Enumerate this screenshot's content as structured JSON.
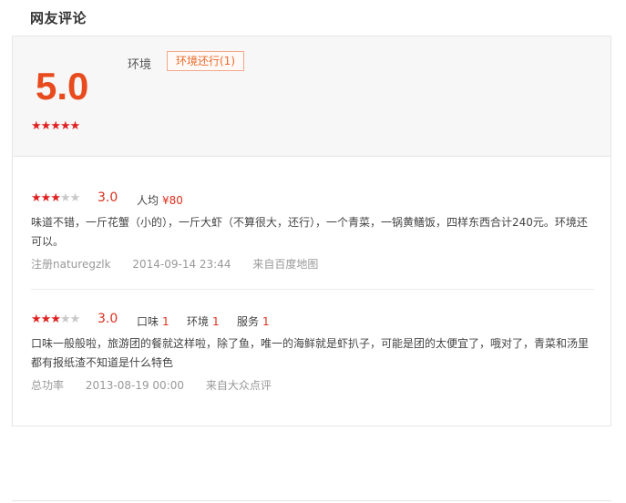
{
  "section_title": "网友评论",
  "summary": {
    "score": "5.0",
    "stars_filled": 5,
    "stars_total": 5,
    "tag_label": "环境",
    "tag_chip": "环境还行(1)"
  },
  "reviews": [
    {
      "stars_filled": 3,
      "stars_total": 5,
      "rating": "3.0",
      "kv": [
        {
          "k": "人均",
          "v": "¥80"
        }
      ],
      "text": "味道不错，一斤花蟹（小的），一斤大虾（不算很大，还行），一个青菜，一锅黄鳝饭，四样东西合计240元。环境还可以。",
      "author": "注册naturegzlk",
      "time": "2014-09-14 23:44",
      "source": "来自百度地图"
    },
    {
      "stars_filled": 3,
      "stars_total": 5,
      "rating": "3.0",
      "kv": [
        {
          "k": "口味",
          "v": "1"
        },
        {
          "k": "环境",
          "v": "1"
        },
        {
          "k": "服务",
          "v": "1"
        }
      ],
      "text": "口味一般般啦，旅游团的餐就这样啦，除了鱼，唯一的海鲜就是虾扒子，可能是团的太便宜了，哦对了，青菜和汤里都有报纸渣不知道是什么特色",
      "author": "总功率",
      "time": "2013-08-19 00:00",
      "source": "来自大众点评"
    }
  ],
  "colors": {
    "accent": "#e84b1d",
    "star_on": "#e02020",
    "star_off": "#c8c8c8",
    "chip_border": "#f2a98c"
  },
  "icons": {
    "star": "star-icon"
  }
}
